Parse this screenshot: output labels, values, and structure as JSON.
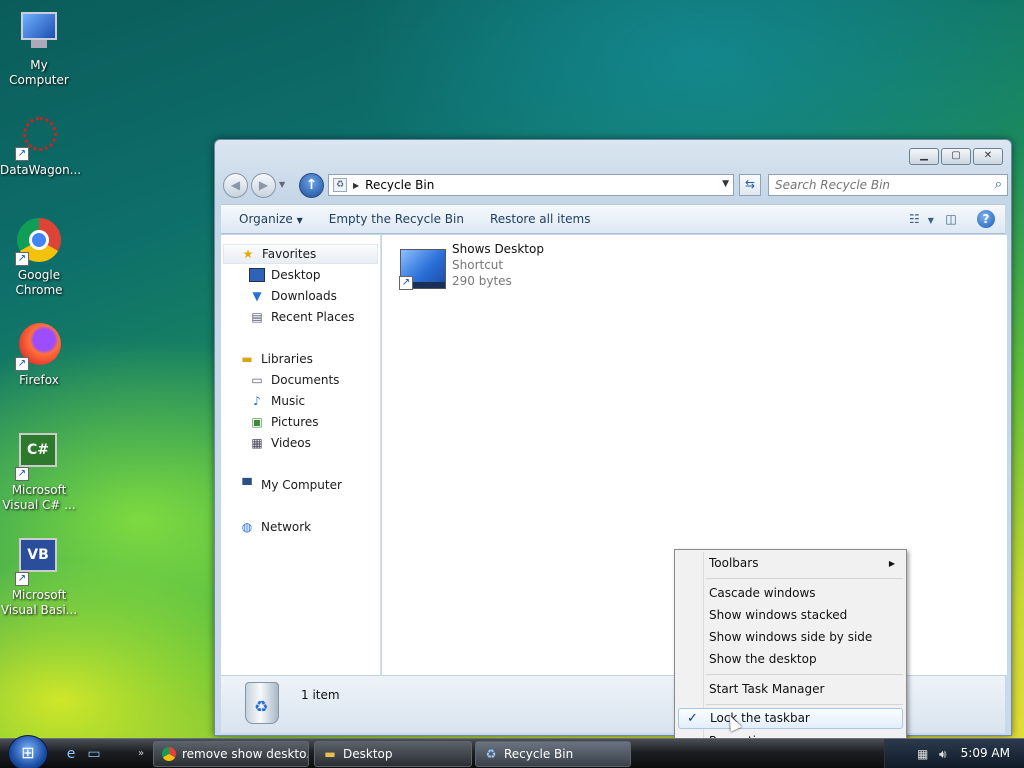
{
  "desktop": {
    "icons": [
      {
        "label": "My Computer",
        "icon": "monitor-icon"
      },
      {
        "label": "DataWagon...",
        "icon": "datawagon-icon"
      },
      {
        "label": "Google Chrome",
        "icon": "chrome-icon"
      },
      {
        "label": "Firefox",
        "icon": "firefox-icon"
      },
      {
        "label": "Microsoft Visual C# ...",
        "icon": "csharp-icon"
      },
      {
        "label": "Microsoft Visual Basi...",
        "icon": "vb-icon"
      }
    ]
  },
  "window": {
    "address": "Recycle Bin",
    "search_placeholder": "Search Recycle Bin",
    "toolbar": {
      "organize": "Organize",
      "empty": "Empty the Recycle Bin",
      "restore": "Restore all items"
    },
    "nav": {
      "favorites": "Favorites",
      "desktop": "Desktop",
      "downloads": "Downloads",
      "recent": "Recent Places",
      "libraries": "Libraries",
      "documents": "Documents",
      "music": "Music",
      "pictures": "Pictures",
      "videos": "Videos",
      "computer": "My Computer",
      "network": "Network"
    },
    "file": {
      "name": "Shows Desktop",
      "type": "Shortcut",
      "size": "290 bytes"
    },
    "details": {
      "count": "1 item"
    }
  },
  "context_menu": {
    "toolbars": "Toolbars",
    "cascade": "Cascade windows",
    "stacked": "Show windows stacked",
    "side_by_side": "Show windows side by side",
    "show_desktop": "Show the desktop",
    "task_manager": "Start Task Manager",
    "lock": "Lock the taskbar",
    "lock_checked": true,
    "properties": "Properties"
  },
  "taskbar": {
    "buttons": [
      {
        "label": "remove show deskto...",
        "icon": "chrome-icon"
      },
      {
        "label": "Desktop",
        "icon": "folder-icon"
      },
      {
        "label": "Recycle Bin",
        "icon": "recycle-bin-icon"
      }
    ],
    "clock": "5:09 AM"
  }
}
